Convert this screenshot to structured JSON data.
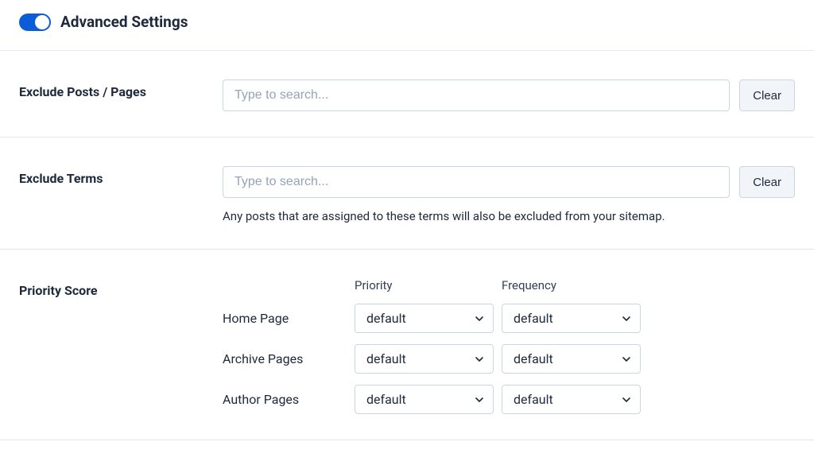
{
  "header": {
    "title": "Advanced Settings",
    "toggle_on": true
  },
  "exclude_posts": {
    "label": "Exclude Posts / Pages",
    "search_placeholder": "Type to search...",
    "clear_button": "Clear"
  },
  "exclude_terms": {
    "label": "Exclude Terms",
    "search_placeholder": "Type to search...",
    "clear_button": "Clear",
    "help_text": "Any posts that are assigned to these terms will also be excluded from your sitemap."
  },
  "priority_score": {
    "label": "Priority Score",
    "columns": {
      "priority": "Priority",
      "frequency": "Frequency"
    },
    "rows": [
      {
        "label": "Home Page",
        "priority": "default",
        "frequency": "default"
      },
      {
        "label": "Archive Pages",
        "priority": "default",
        "frequency": "default"
      },
      {
        "label": "Author Pages",
        "priority": "default",
        "frequency": "default"
      }
    ]
  }
}
